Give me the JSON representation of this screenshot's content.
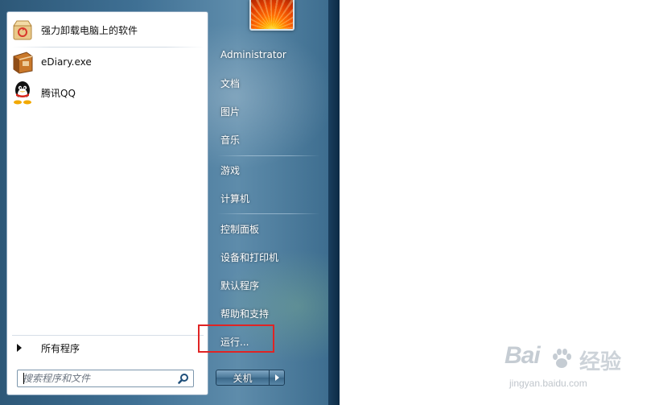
{
  "start_menu": {
    "programs": [
      {
        "label": "强力卸载电脑上的软件",
        "icon": "uninstall-box-icon"
      },
      {
        "label": "eDiary.exe",
        "icon": "diary-book-icon"
      },
      {
        "label": "腾讯QQ",
        "icon": "qq-penguin-icon"
      }
    ],
    "all_programs_label": "所有程序",
    "search": {
      "placeholder": "搜索程序和文件",
      "value": ""
    },
    "user_name": "Administrator",
    "right_items": [
      {
        "label": "文档"
      },
      {
        "label": "图片"
      },
      {
        "label": "音乐"
      },
      {
        "label": "游戏"
      },
      {
        "label": "计算机"
      },
      {
        "label": "控制面板"
      },
      {
        "label": "设备和打印机"
      },
      {
        "label": "默认程序"
      },
      {
        "label": "帮助和支持"
      },
      {
        "label": "运行..."
      }
    ],
    "shutdown_label": "关机",
    "highlight_color": "#e02424"
  },
  "watermark": {
    "brand": "Bai",
    "brand_cn": "经验",
    "url": "jingyan.baidu.com"
  }
}
